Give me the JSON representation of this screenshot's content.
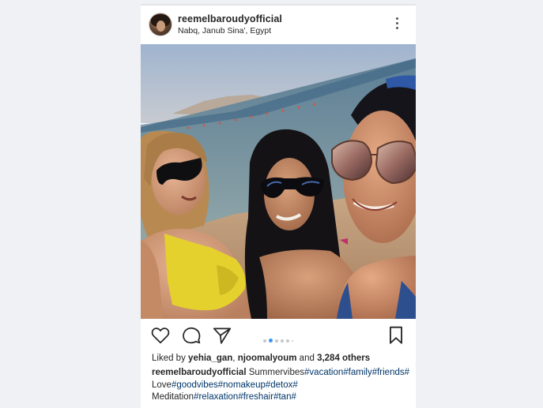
{
  "post": {
    "username": "reemelbaroudyofficial",
    "location": "Nabq, Janub Sina', Egypt",
    "likes": {
      "prefix": "Liked by",
      "user1": "yehia_gan",
      "separator": ",",
      "user2": "njoomalyoum",
      "conjunction": "and",
      "others": "3,284 others"
    },
    "caption": {
      "author": "reemelbaroudyofficial",
      "text": "Summervibes",
      "line1_tags": [
        "#vacation",
        "#family",
        "#friends",
        "#"
      ],
      "line2_lead": "Love",
      "line2_tags": [
        "#goodvibes",
        "#nomakeup",
        "#detox",
        "#"
      ],
      "line3_lead": "Meditation",
      "line3_tags": [
        "#relaxation",
        "#freshair",
        "#tan",
        "#"
      ]
    },
    "carousel": {
      "count": 6,
      "active_index": 1
    }
  },
  "icons": {
    "more": "more-vertical-icon",
    "like": "heart-icon",
    "comment": "comment-icon",
    "share": "send-icon",
    "save": "bookmark-icon"
  },
  "colors": {
    "text": "#262626",
    "hashtag": "#003569",
    "dot_active": "#3897f0",
    "dot_inactive": "#c7c7c7",
    "background": "#f0f1f5"
  }
}
